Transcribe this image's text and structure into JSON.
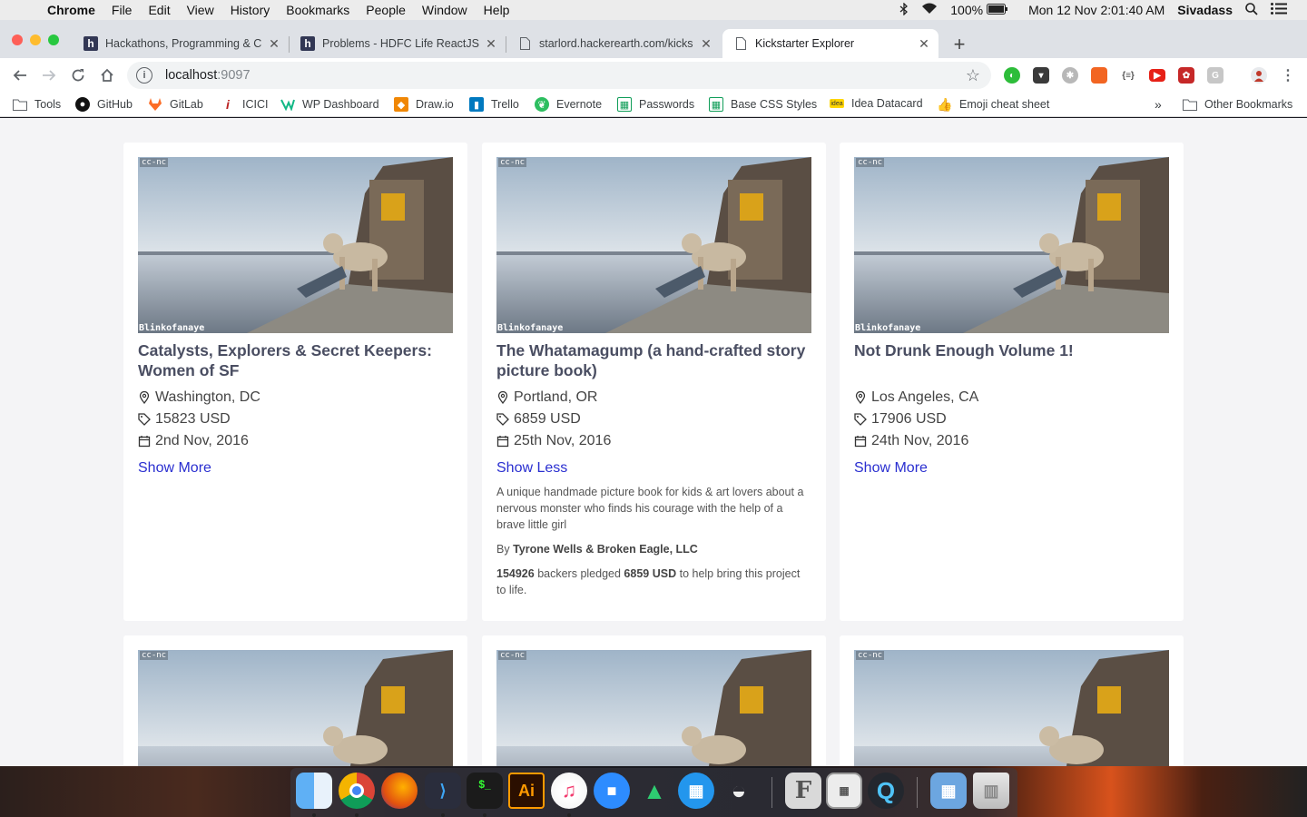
{
  "menubar": {
    "app": "Chrome",
    "items": [
      "File",
      "Edit",
      "View",
      "History",
      "Bookmarks",
      "People",
      "Window",
      "Help"
    ],
    "battery": "100%",
    "datetime": "Mon 12 Nov  2:01:40 AM",
    "user": "Sivadass"
  },
  "tabs": [
    {
      "title": "Hackathons, Programming & C",
      "icon": "hackerearth-icon"
    },
    {
      "title": "Problems - HDFC Life ReactJS",
      "icon": "hackerearth-icon"
    },
    {
      "title": "starlord.hackerearth.com/kicks",
      "icon": "page-icon"
    },
    {
      "title": "Kickstarter Explorer",
      "icon": "page-icon"
    }
  ],
  "address": {
    "host": "localhost",
    "port": ":9097"
  },
  "bookmarks": [
    "Tools",
    "GitHub",
    "GitLab",
    "ICICI",
    "WP Dashboard",
    "Draw.io",
    "Trello",
    "Evernote",
    "Passwords",
    "Base CSS Styles",
    "Idea Datacard",
    "Emoji cheat sheet"
  ],
  "other_bookmarks": "Other Bookmarks",
  "extension_badge": "off",
  "image_text": {
    "license": "cc-nc",
    "credit": "Blinkofanaye"
  },
  "cards": [
    {
      "title": "Catalysts, Explorers & Secret Keepers: Women of SF",
      "location": "Washington, DC",
      "amount": "15823 USD",
      "date": "2nd Nov, 2016",
      "toggle": "Show More"
    },
    {
      "title": "The Whatamagump (a hand-crafted story picture book)",
      "location": "Portland, OR",
      "amount": "6859 USD",
      "date": "25th Nov, 2016",
      "toggle": "Show Less",
      "description": "A unique handmade picture book for kids & art lovers about a nervous monster who finds his courage with the help of a brave little girl",
      "by_prefix": "By",
      "by": "Tyrone Wells & Broken Eagle, LLC",
      "backers": "154926",
      "backers_text": "backers pledged",
      "pledged": "6859 USD",
      "pledged_suffix": "to help bring this project to life."
    },
    {
      "title": "Not Drunk Enough Volume 1!",
      "location": "Los Angeles, CA",
      "amount": "17906 USD",
      "date": "24th Nov, 2016",
      "toggle": "Show More"
    }
  ],
  "dock": {
    "illustrator_label": "Ai",
    "figma_label": "F"
  }
}
